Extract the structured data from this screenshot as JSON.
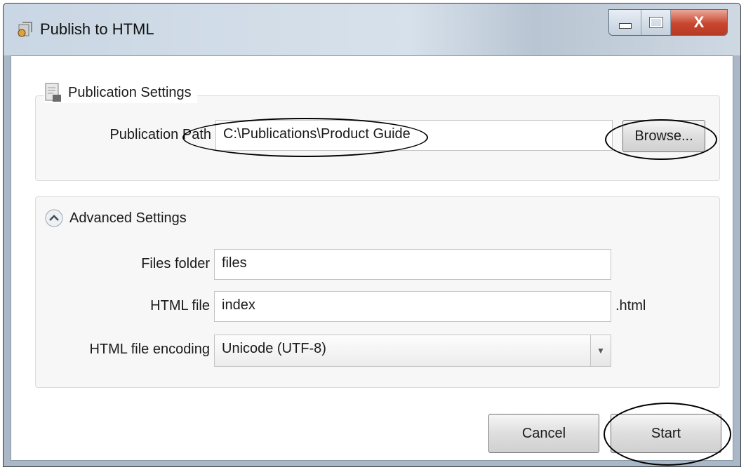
{
  "window": {
    "title": "Publish to HTML",
    "close_glyph": "X",
    "icons": {
      "app": "publish-app-icon",
      "minimize": "minimize-icon",
      "maximize": "maximize-icon",
      "close": "close-icon"
    }
  },
  "publication": {
    "header": "Publication Settings",
    "header_icon": "document-settings-icon",
    "path_label": "Publication Path",
    "path_value": "C:\\Publications\\Product Guide",
    "browse_label": "Browse..."
  },
  "advanced": {
    "header": "Advanced Settings",
    "header_icon": "collapse-chevron-up-icon",
    "files_folder_label": "Files folder",
    "files_folder_value": "files",
    "html_file_label": "HTML file",
    "html_file_value": "index",
    "html_file_suffix": ".html",
    "encoding_label": "HTML file encoding",
    "encoding_value": "Unicode (UTF-8)"
  },
  "footer": {
    "cancel_label": "Cancel",
    "start_label": "Start"
  },
  "colors": {
    "annotation_circles": "#000000",
    "close_button": "#c9452e"
  }
}
